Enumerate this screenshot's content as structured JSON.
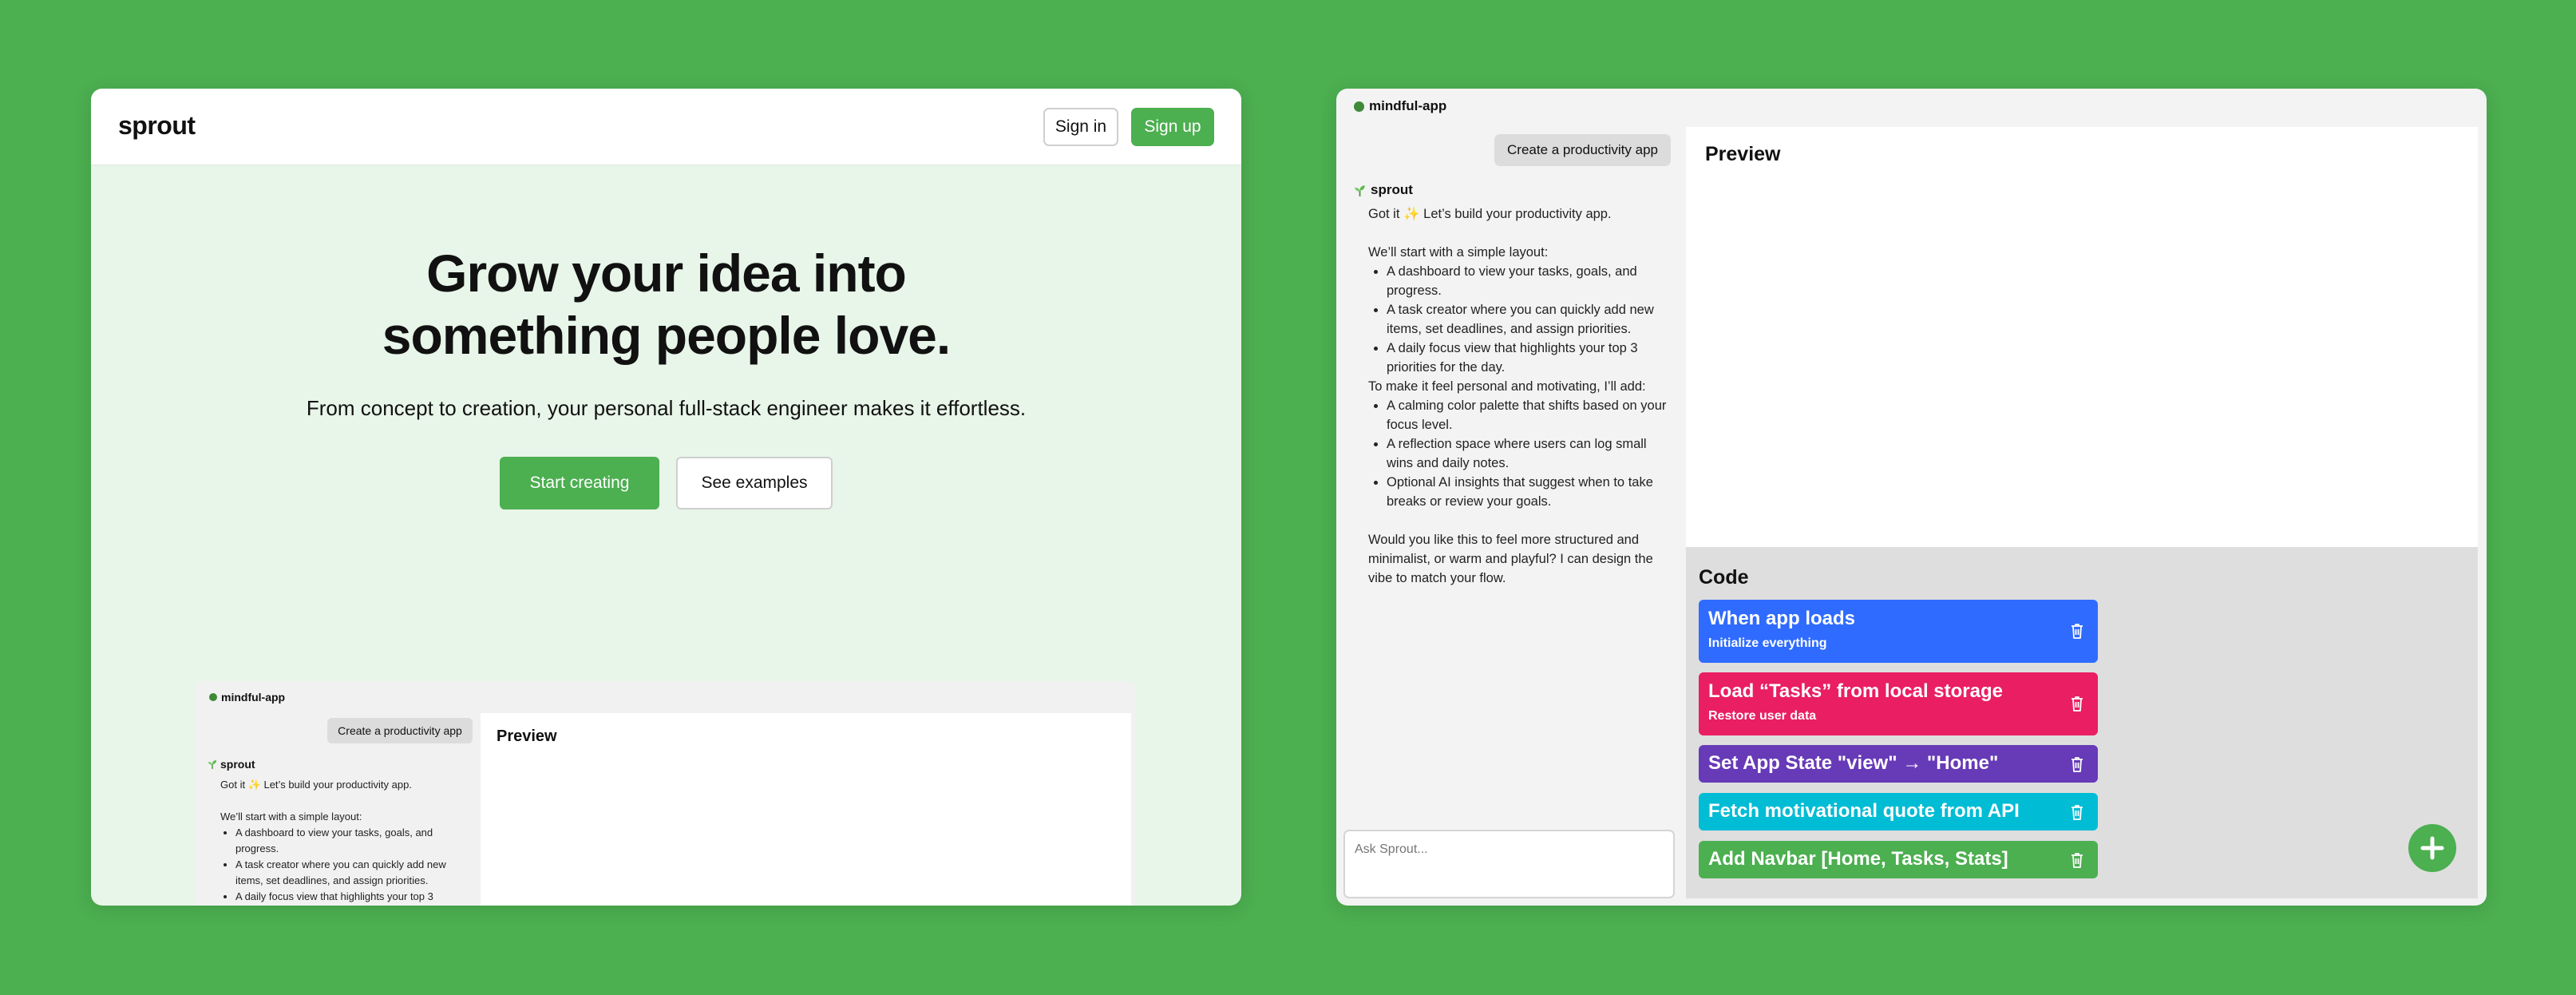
{
  "landing": {
    "logo": "sprout",
    "signin": "Sign in",
    "signup": "Sign up",
    "hero_line1": "Grow your idea into",
    "hero_line2": "something people love.",
    "subtitle": "From concept to creation, your personal full-stack engineer makes it effortless.",
    "start_button": "Start creating",
    "examples_button": "See examples"
  },
  "app": {
    "name": "mindful-app",
    "user_message": "Create a productivity app",
    "assistant_name": "sprout",
    "reply_intro": "Got it ✨ Let’s build your productivity app.",
    "layout_intro": "We’ll start with a simple layout:",
    "layout_items": [
      "A dashboard to view your tasks, goals, and progress.",
      "A task creator where you can quickly add new items, set deadlines, and assign priorities.",
      "A daily focus view that highlights your top 3 priorities for the day."
    ],
    "personal_intro": "To make it feel personal and motivating, I’ll add:",
    "personal_items": [
      "A calming color palette that shifts based on your focus level.",
      "A reflection space where users can log small wins and daily notes.",
      "Optional AI insights that suggest when to take breaks or review your goals."
    ],
    "closing": "Would you like this to feel more structured and minimalist, or warm and playful? I can design the vibe to match your flow.",
    "ask_placeholder": "Ask Sprout...",
    "preview_title": "Preview",
    "code_title": "Code",
    "blocks": [
      {
        "title": "When app loads",
        "subtitle": "Initialize everything",
        "color": "#2f6bff"
      },
      {
        "title": "Load “Tasks” from local storage",
        "subtitle": "Restore user data",
        "color": "#e91e63"
      },
      {
        "title": "Set App State \"view\" → \"Home\"",
        "subtitle": "",
        "color": "#673ab7"
      },
      {
        "title": "Fetch motivational quote from API",
        "subtitle": "",
        "color": "#00bcd4"
      },
      {
        "title": "Add Navbar [Home, Tasks, Stats]",
        "subtitle": "",
        "color": "#4caf50"
      }
    ]
  },
  "colors": {
    "page_bg": "#4caf50",
    "accent": "#4caf50",
    "hero_bg": "#e8f5e9"
  }
}
